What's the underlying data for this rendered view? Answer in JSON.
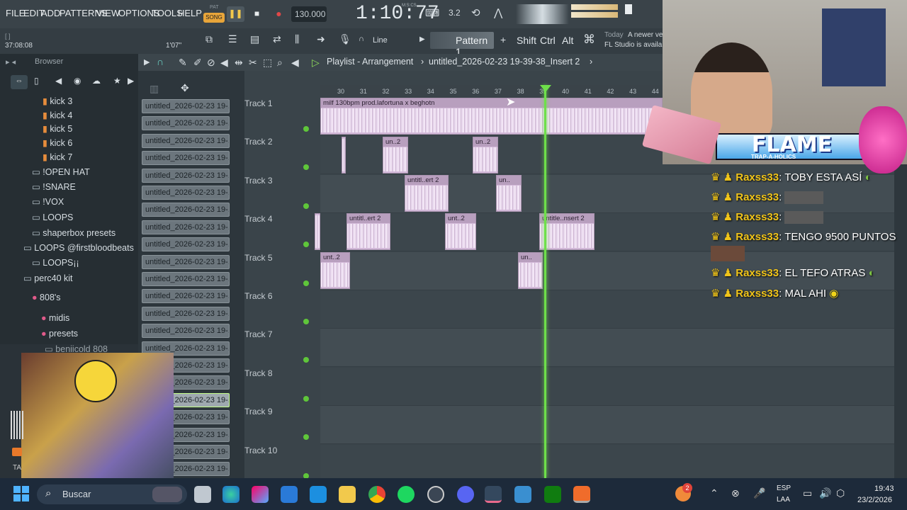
{
  "menu": {
    "items": [
      "FILE",
      "EDIT",
      "ADD",
      "PATTERNS",
      "VIEW",
      "OPTIONS",
      "TOOLS",
      "HELP"
    ],
    "pat_song_label": "SONG",
    "pat_label": "PAT",
    "tempo": "130.000",
    "time": "1:10:77",
    "time_unit": "M:S:CS",
    "cpu": "3.2"
  },
  "toolbar2": {
    "left_time": "37:08:08",
    "left_small": "1'07\"",
    "snap": "Line",
    "pattern": "Pattern 1",
    "shift": "Shift",
    "ctrl": "Ctrl",
    "alt": "Alt",
    "news_today": "Today",
    "news_text1": "A newer ve",
    "news_text2": "FL Studio is availa"
  },
  "browser": {
    "title": "Browser",
    "items": [
      "kick 3",
      "kick 4",
      "kick 5",
      "kick 6",
      "kick 7",
      "!OPEN HAT",
      "!SNARE",
      "!VOX",
      "LOOPS",
      "shaperbox presets",
      "LOOPS @firstbloodbeats",
      "LOOPS¡¡",
      "perc40 kit",
      "808's",
      "midis",
      "presets",
      "beniicold 808"
    ]
  },
  "clips": {
    "label": "untitled_2026-02-23 19-...",
    "count": 22
  },
  "playlist": {
    "title": "Playlist - Arrangement",
    "breadcrumb": "untitled_2026-02-23 19-39-38_Insert 2",
    "ruler": [
      "30",
      "31",
      "32",
      "33",
      "34",
      "35",
      "36",
      "37",
      "38",
      "39",
      "40",
      "41",
      "42",
      "43",
      "44"
    ],
    "tracks": [
      "Track 1",
      "Track 2",
      "Track 3",
      "Track 4",
      "Track 5",
      "Track 6",
      "Track 7",
      "Track 8",
      "Track 9",
      "Track 10"
    ],
    "track1_clip": "milf 130bpm prod.lafortuna x beghotn",
    "clip_un2": "un..2",
    "clip_untitl_ert2": "untitl..ert 2",
    "clip_un": "un..",
    "clip_unt2": "unt..2",
    "clip_untitle_nsert2": "untitle..nsert 2"
  },
  "chat": {
    "lines": [
      {
        "user": "Raxss33",
        "text": ": TOBY ESTA ASÍ"
      },
      {
        "user": "Raxss33",
        "text": ":"
      },
      {
        "user": "Raxss33",
        "text": ":"
      },
      {
        "user": "Raxss33",
        "text": ": TENGO 9500 PUNTOS"
      },
      {
        "user": "Raxss33",
        "text": ": EL TEFO ATRAS"
      },
      {
        "user": "Raxss33",
        "text": ": MAL AHI"
      }
    ]
  },
  "overlay": {
    "brand": "FLAME",
    "brand_sub": "TRAP-A-HOLICS"
  },
  "taskbar": {
    "search_placeholder": "Buscar",
    "lang1": "ESP",
    "lang2": "LAA",
    "time": "19:43",
    "date": "23/2/2026",
    "badge": "2",
    "side_label": "TA"
  },
  "colors": {
    "playhead": "#6ee04a",
    "clip": "#d3b9d9",
    "chat_user": "#f0c419",
    "led": "#5fc63a"
  }
}
